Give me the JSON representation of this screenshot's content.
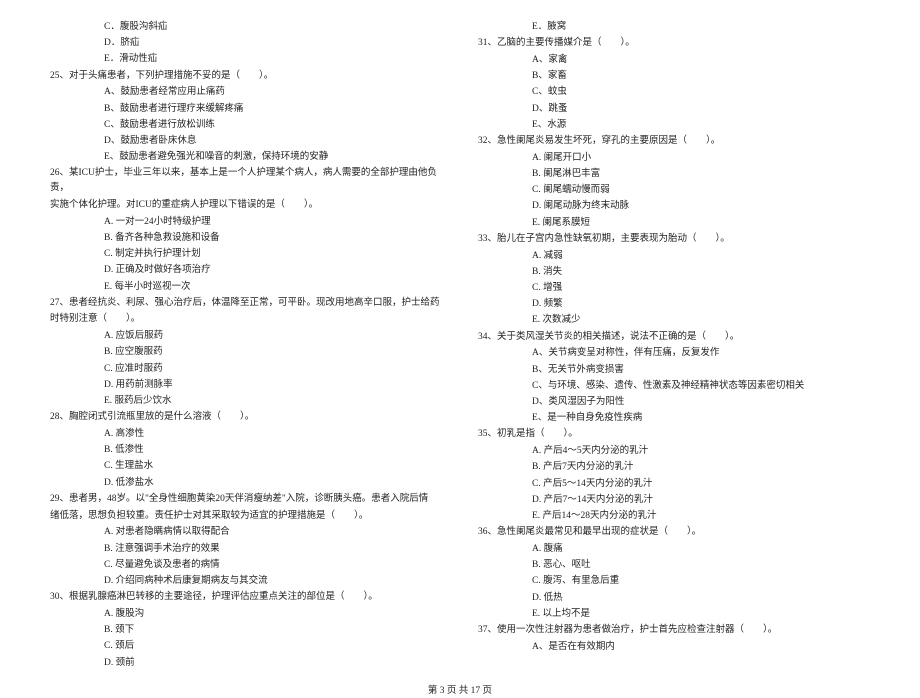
{
  "left": {
    "pre_options": [
      "C．腹股沟斜疝",
      "D．脐疝",
      "E．滑动性疝"
    ],
    "q25": {
      "text": "25、对于头痛患者，下列护理措施不妥的是（　　）。",
      "opts": [
        "A、鼓励患者经常应用止痛药",
        "B、鼓励患者进行理疗来缓解疼痛",
        "C、鼓励患者进行放松训练",
        "D、鼓励患者卧床休息",
        "E、鼓励患者避免强光和噪音的刺激，保持环境的安静"
      ]
    },
    "q26": {
      "text1": "26、某ICU护士，毕业三年以来，基本上是一个人护理某个病人，病人需要的全部护理由他负责，",
      "text2": "实施个体化护理。对ICU的重症病人护理以下错误的是（　　）。",
      "opts": [
        "A. 一对一24小时特级护理",
        "B. 备齐各种急救设施和设备",
        "C. 制定并执行护理计划",
        "D. 正确及时做好各项治疗",
        "E. 每半小时巡视一次"
      ]
    },
    "q27": {
      "text1": "27、患者经抗炎、利尿、强心治疗后，体温降至正常，可平卧。现改用地高辛口服，护士给药",
      "text2": "时特别注意（　　）。",
      "opts": [
        "A. 应饭后服药",
        "B. 应空腹服药",
        "C. 应准时服药",
        "D. 用药前测脉率",
        "E. 服药后少饮水"
      ]
    },
    "q28": {
      "text": "28、胸腔闭式引流瓶里放的是什么溶液（　　）。",
      "opts": [
        "A. 高渗性",
        "B. 低渗性",
        "C. 生理盐水",
        "D. 低渗盐水"
      ]
    },
    "q29": {
      "text1": "29、患者男，48岁。以\"全身性细胞黄染20天伴消瘦纳差\"入院，诊断胰头癌。患者入院后情",
      "text2": "绪低落，思想负担较重。责任护士对其采取较为适宜的护理措施是（　　）。",
      "opts": [
        "A. 对患者隐瞒病情以取得配合",
        "B. 注意强调手术治疗的效果",
        "C. 尽量避免谈及患者的病情",
        "D. 介绍同病种术后康复期病友与其交流"
      ]
    },
    "q30": {
      "text": "30、根据乳腺癌淋巴转移的主要途径，护理评估应重点关注的部位是（　　）。",
      "opts": [
        "A. 腹股沟",
        "B. 颈下",
        "C. 颈后",
        "D. 颈前"
      ]
    }
  },
  "right": {
    "pre_options": [
      "E．腋窝"
    ],
    "q31": {
      "text": "31、乙脑的主要传播媒介是（　　）。",
      "opts": [
        "A、家禽",
        "B、家畜",
        "C、蚊虫",
        "D、跳蚤",
        "E、水源"
      ]
    },
    "q32": {
      "text": "32、急性阑尾炎易发生坏死，穿孔的主要原因是（　　）。",
      "opts": [
        "A. 阑尾开口小",
        "B. 阑尾淋巴丰富",
        "C. 阑尾蠕动慢而弱",
        "D. 阑尾动脉为终末动脉",
        "E. 阑尾系膜短"
      ]
    },
    "q33": {
      "text": "33、胎儿在子宫内急性缺氧初期，主要表现为胎动（　　）。",
      "opts": [
        "A. 减弱",
        "B. 消失",
        "C. 增强",
        "D. 频繁",
        "E. 次数减少"
      ]
    },
    "q34": {
      "text": "34、关于类风湿关节炎的相关描述，说法不正确的是（　　）。",
      "opts": [
        "A、关节病变呈对称性，伴有压痛，反复发作",
        "B、无关节外病变损害",
        "C、与环境、感染、遗传、性激素及神经精神状态等因素密切相关",
        "D、类风湿因子为阳性",
        "E、是一种自身免疫性疾病"
      ]
    },
    "q35": {
      "text": "35、初乳是指（　　）。",
      "opts": [
        "A. 产后4～5天内分泌的乳汁",
        "B. 产后7天内分泌的乳汁",
        "C. 产后5～14天内分泌的乳汁",
        "D. 产后7～14天内分泌的乳汁",
        "E. 产后14～28天内分泌的乳汁"
      ]
    },
    "q36": {
      "text": "36、急性阑尾炎最常见和最早出现的症状是（　　）。",
      "opts": [
        "A. 腹痛",
        "B. 恶心、呕吐",
        "C. 腹泻、有里急后重",
        "D. 低热",
        "E. 以上均不是"
      ]
    },
    "q37": {
      "text": "37、使用一次性注射器为患者做治疗，护士首先应检查注射器（　　）。",
      "opts": [
        "A、是否在有效期内"
      ]
    }
  },
  "footer": "第 3 页 共 17 页"
}
